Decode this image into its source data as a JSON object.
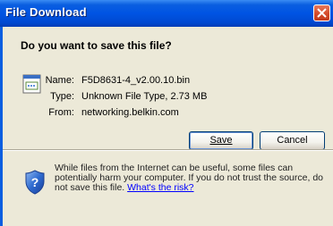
{
  "window": {
    "title": "File Download"
  },
  "dialog": {
    "question": "Do you want to save this file?",
    "file_icon": "binary-file-icon",
    "name_label": "Name:",
    "name_value": "F5D8631-4_v2.00.10.bin",
    "type_label": "Type:",
    "type_value": "Unknown File Type, 2.73 MB",
    "from_label": "From:",
    "from_value": "networking.belkin.com",
    "save_button": "Save",
    "cancel_button": "Cancel"
  },
  "warning": {
    "icon": "shield-question-icon",
    "text": "While files from the Internet can be useful, some files can potentially harm your computer. If you do not trust the source, do not save this file.",
    "link": "What's the risk?"
  },
  "colors": {
    "titlebar": "#0054e3",
    "dialog_bg": "#ece9d8",
    "close_button": "#d54b2a",
    "link": "#0000ff"
  }
}
